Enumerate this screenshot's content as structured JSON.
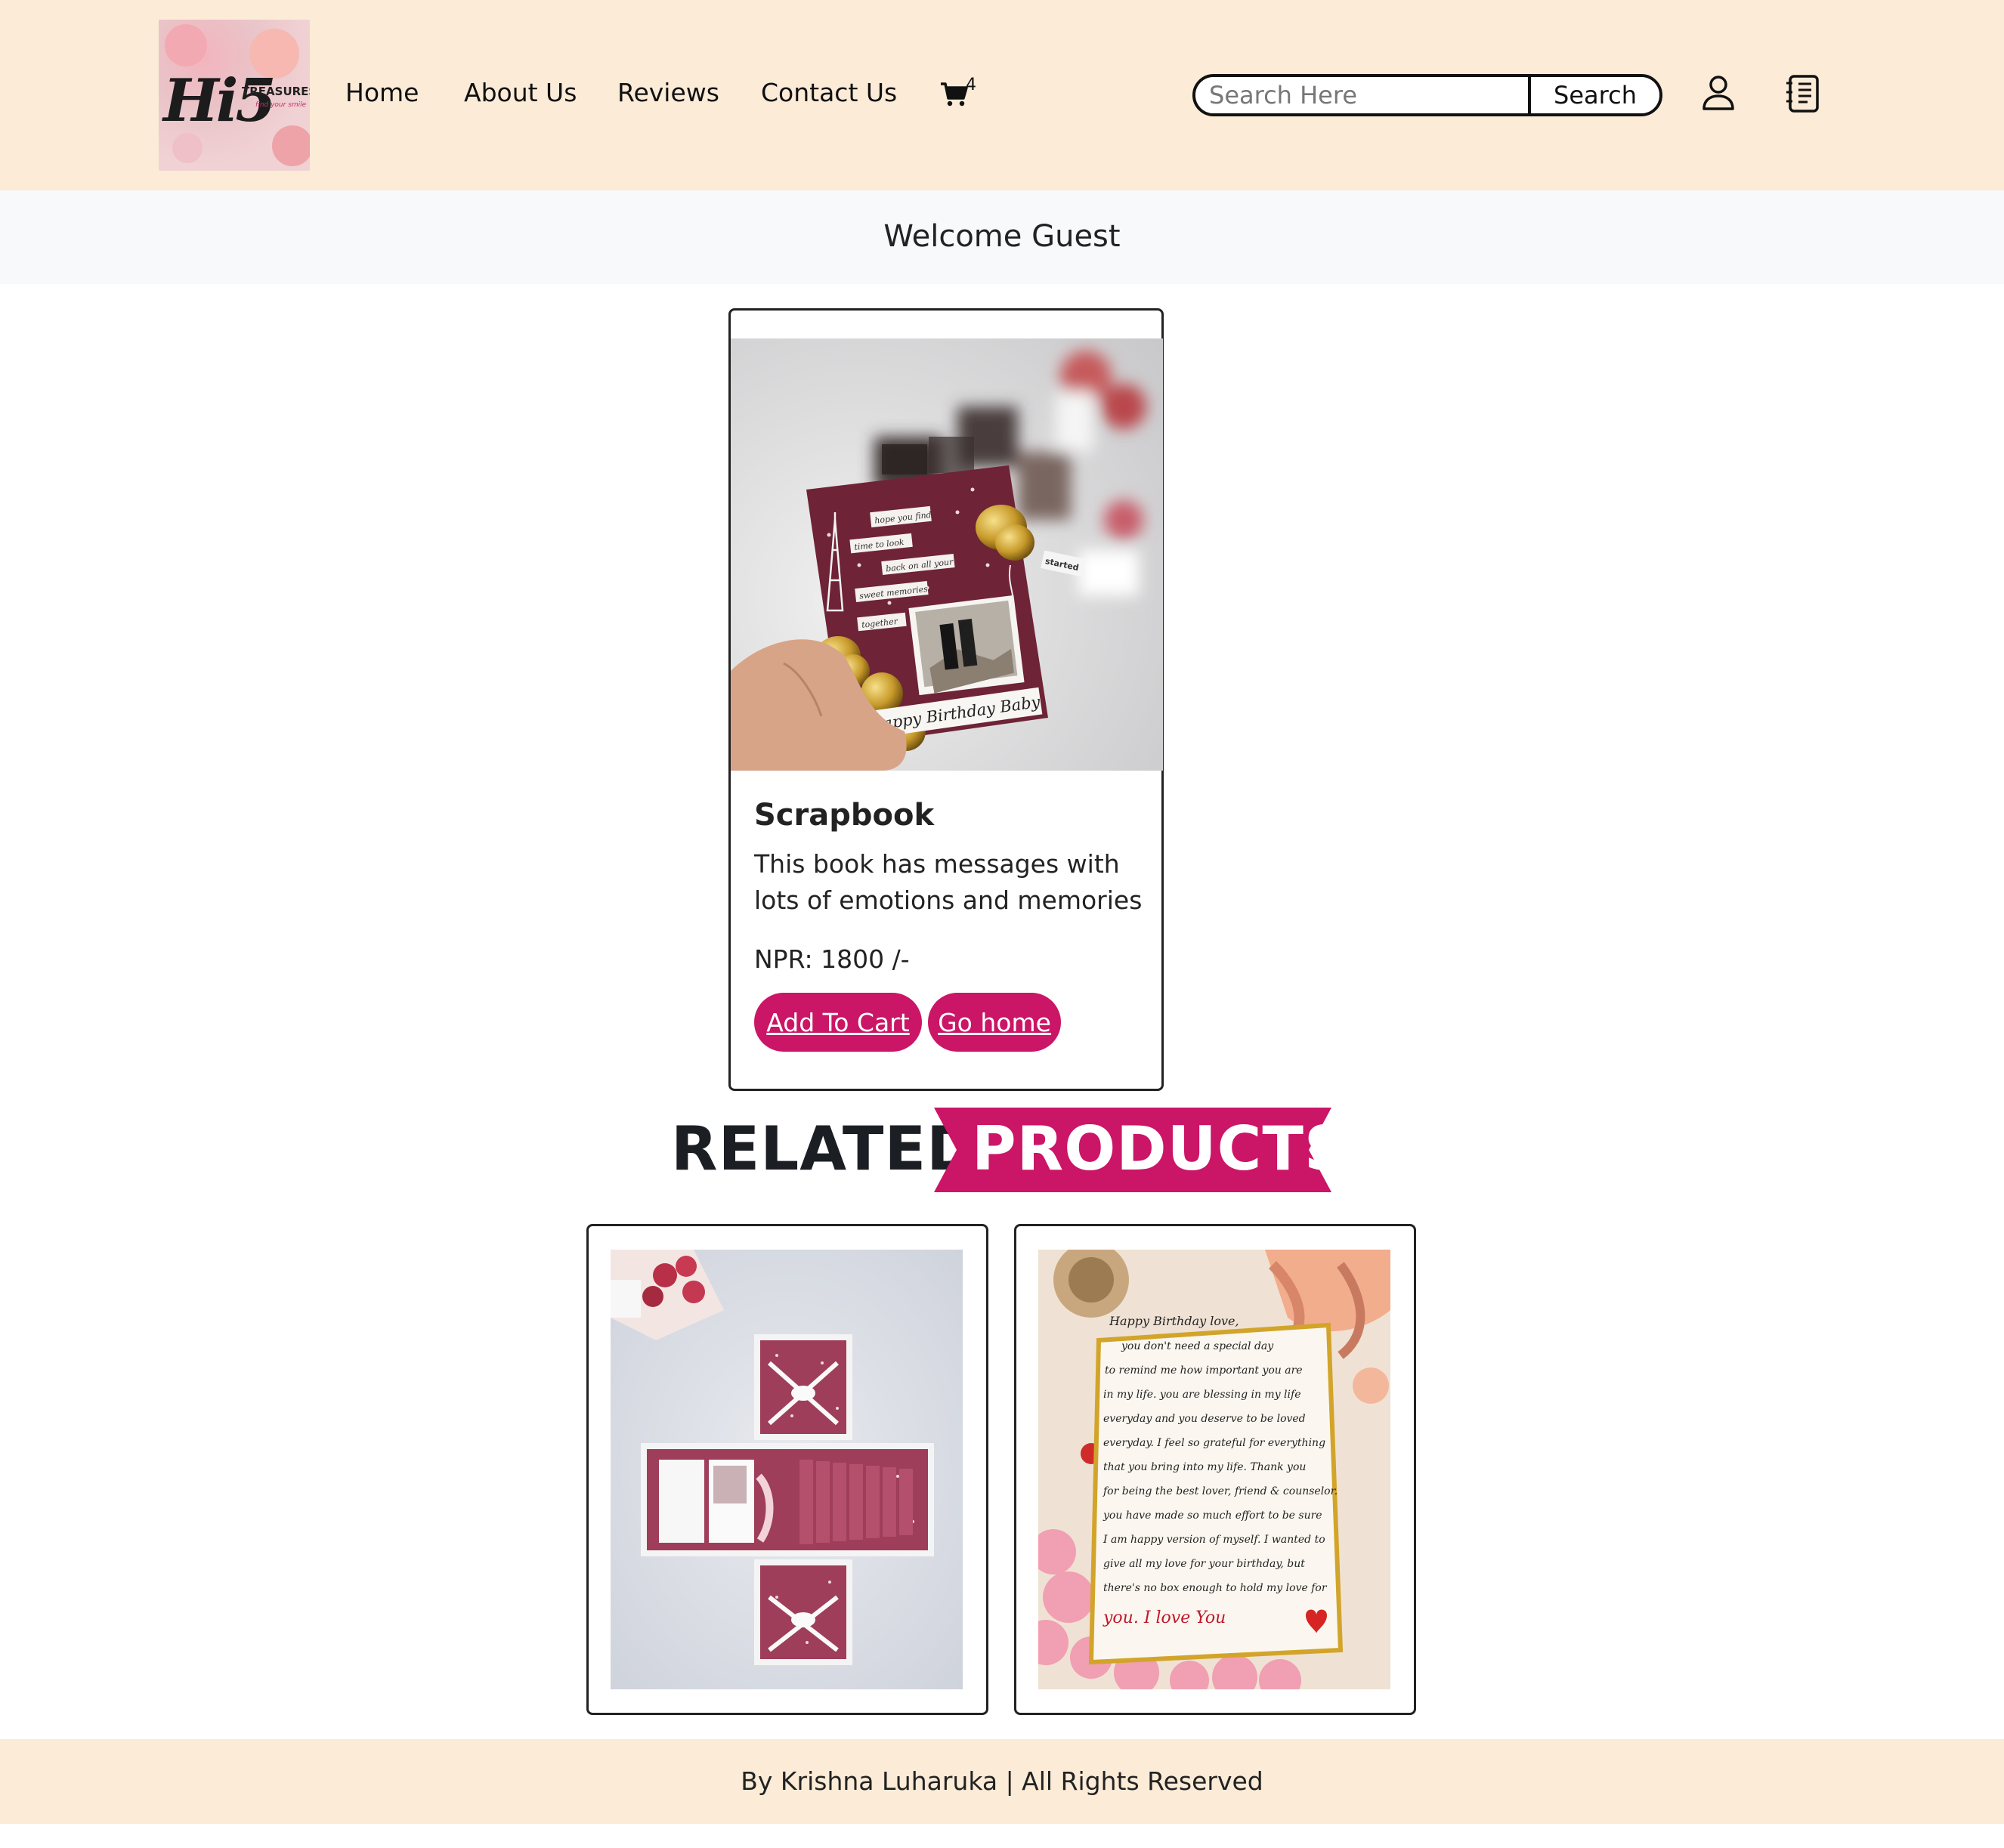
{
  "header": {
    "logo": {
      "main": "Hi5",
      "sub": "TREASURES",
      "tagline": "find your smile"
    },
    "nav": [
      "Home",
      "About Us",
      "Reviews",
      "Contact Us"
    ],
    "cart_count": "4",
    "search": {
      "placeholder": "Search Here",
      "button": "Search"
    }
  },
  "welcome": "Welcome Guest",
  "product": {
    "title": "Scrapbook",
    "description": "This book has messages with lots of emotions and memories",
    "price": "NPR: 1800 /-",
    "add_to_cart": "Add To Cart",
    "go_home": "Go home",
    "image_text": {
      "caption": "Happy Birthday Baby",
      "notes": [
        "hope you find",
        "time to look",
        "back on all your",
        "sweet memories",
        "together"
      ],
      "tag": "started"
    }
  },
  "related": {
    "heading_1": "RELATED",
    "heading_2": "PRODUCTS",
    "letter_lines": [
      "Happy Birthday love,",
      "you don't need a special day",
      "to remind me how important you are",
      "in my life. you are blessing in my life",
      "everyday and you deserve to be loved",
      "everyday. I feel so grateful for everything",
      "that you bring into my life. Thank you",
      "for being the best lover, friend & counselor.",
      "you have made so much effort to be sure",
      "I am happy version of myself. I wanted to",
      "give all my love for your birthday, but",
      "there's no box enough to hold my love for",
      "you. I love You"
    ]
  },
  "footer": "By Krishna Luharuka | All Rights Reserved",
  "colors": {
    "header_bg": "#fbebd7",
    "accent": "#cb1566",
    "welcome_bg": "#f8f9fa"
  }
}
